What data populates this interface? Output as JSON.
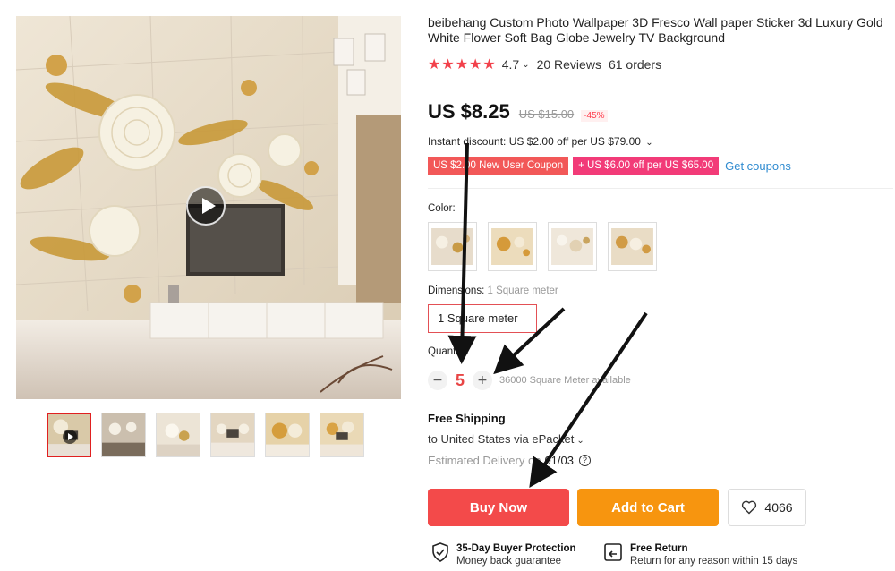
{
  "product": {
    "title": "beibehang Custom Photo Wallpaper 3D Fresco Wall paper Sticker 3d Luxury Gold White Flower Soft Bag Globe Jewelry TV Background",
    "stars": "★★★★★",
    "rating": "4.7",
    "reviews": "20 Reviews",
    "orders": "61 orders"
  },
  "price": {
    "current": "US $8.25",
    "original": "US $15.00",
    "discount": "-45%"
  },
  "promo": {
    "instant_discount": "Instant discount: US $2.00 off per US $79.00",
    "coupon1": "US $2.00 New User Coupon",
    "coupon2": "+ US $6.00 off per US $65.00",
    "get_coupons": "Get coupons"
  },
  "options": {
    "color_label": "Color:",
    "dimensions_label": "Dimensions:",
    "dimensions_value": "1 Square meter",
    "dimension_option": "1 Square meter",
    "quantity_label": "Quantity:",
    "quantity_value": "5",
    "minus": "−",
    "plus": "+",
    "available": "36000 Square Meter available"
  },
  "shipping": {
    "title": "Free Shipping",
    "destination": "to United States via ePacket",
    "delivery_label": "Estimated Delivery on",
    "delivery_date": "01/03",
    "help": "?"
  },
  "actions": {
    "buy_now": "Buy Now",
    "add_to_cart": "Add to Cart",
    "wishlist_count": "4066"
  },
  "guarantees": {
    "buyer_protection_title": "35-Day Buyer Protection",
    "buyer_protection_sub": "Money back guarantee",
    "free_return_title": "Free Return",
    "free_return_sub": "Return for any reason within 15 days"
  },
  "icons": {
    "play": "play-icon",
    "star": "star-icon",
    "heart": "heart-icon",
    "shield": "shield-check-icon",
    "return": "return-icon"
  },
  "colors": {
    "price_red": "#f34a4a",
    "cart_orange": "#f7950f",
    "coupon_red": "#f25858",
    "coupon_pink": "#f23b78",
    "link_blue": "#2f8bd0"
  }
}
